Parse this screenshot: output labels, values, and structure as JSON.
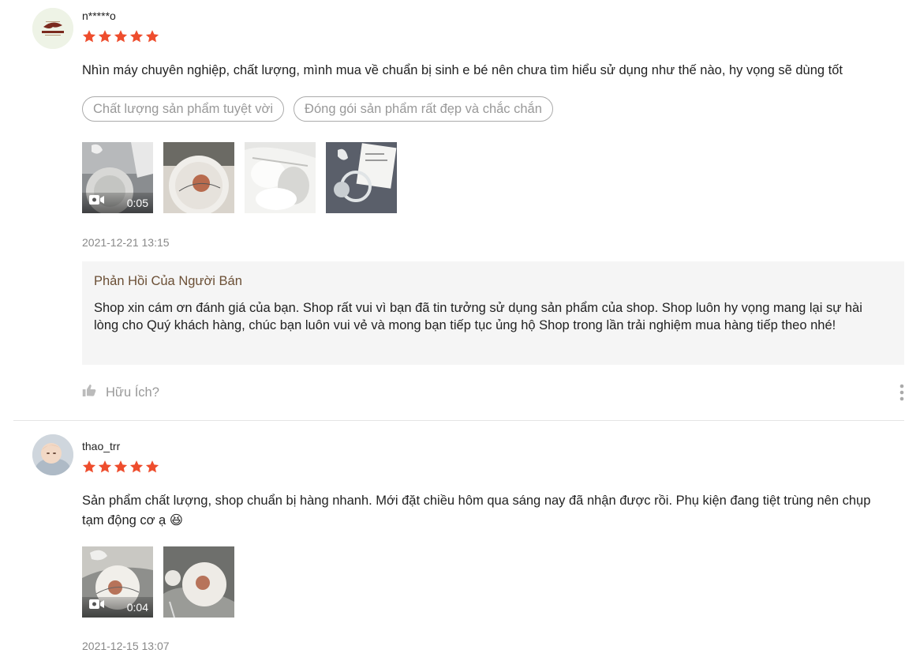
{
  "reviews": [
    {
      "username": "n*****o",
      "rating": 5,
      "comment": "Nhìn máy chuyên nghiệp, chất lượng, mình mua về chuẩn bị sinh e bé nên chưa tìm hiểu sử dụng như thế nào, hy vọng sẽ dùng tốt",
      "tags": [
        "Chất lượng sản phẩm tuyệt vời",
        "Đóng gói sản phẩm rất đẹp và chắc chắn"
      ],
      "video_duration": "0:05",
      "date": "2021-12-21 13:15",
      "seller_reply": {
        "title": "Phản Hồi Của Người Bán",
        "body": "Shop xin cám ơn đánh giá của bạn. Shop rất vui vì bạn đã tin tưởng sử dụng sản phẩm của shop. Shop luôn hy vọng mang lại sự hài lòng cho Quý khách hàng, chúc bạn luôn vui vẻ và mong bạn tiếp tục ủng hộ Shop trong lần trải nghiệm mua hàng tiếp theo nhé!"
      },
      "helpful_label": "Hữu Ích?"
    },
    {
      "username": "thao_trr",
      "rating": 5,
      "comment": "Sản phẩm chất lượng, shop chuẩn bị hàng nhanh. Mới đặt chiều hôm qua sáng nay đã nhận được rồi. Phụ kiện đang tiệt trùng nên chụp tạm động cơ ạ 😆",
      "video_duration": "0:04",
      "date": "2021-12-15 13:07"
    }
  ],
  "colors": {
    "star": "#ee4d2d",
    "reply_title": "#6b4f35"
  },
  "icons": [
    "star-icon",
    "video-camera-icon",
    "thumbs-up-icon",
    "more-vertical-icon"
  ]
}
